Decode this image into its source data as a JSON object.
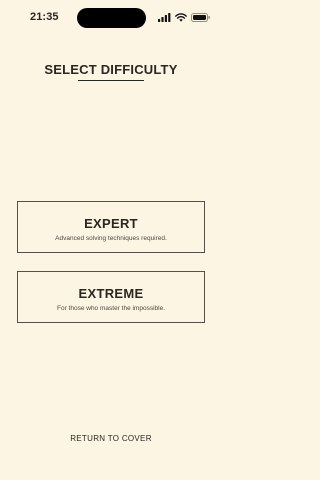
{
  "status_bar": {
    "time": "21:35",
    "icons": [
      "signal-icon",
      "wifi-icon",
      "battery-icon"
    ]
  },
  "header": {
    "title": "SELECT DIFFICULTY"
  },
  "options": [
    {
      "title": "EXPERT",
      "description": "Advanced solving techniques required."
    },
    {
      "title": "EXTREME",
      "description": "For those who master the impossible."
    }
  ],
  "footer": {
    "return_label": "RETURN TO COVER"
  },
  "colors": {
    "background": "#fdf5e3",
    "text": "#2a2620",
    "border": "#55504a"
  }
}
